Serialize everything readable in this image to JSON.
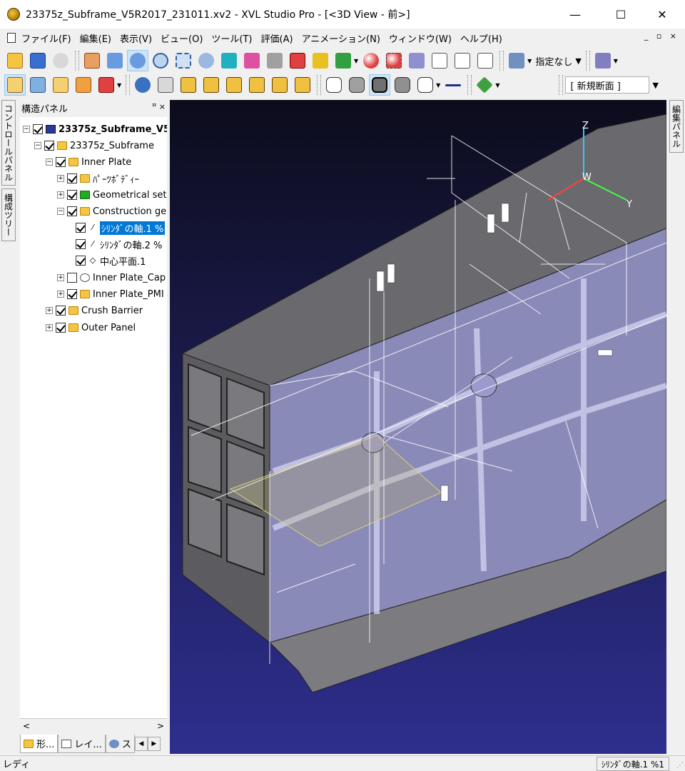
{
  "window": {
    "title": "23375z_Subframe_V5R2017_231011.xv2 - XVL Studio Pro - [<3D View - 前>]",
    "minimize": "—",
    "maximize": "☐",
    "close": "✕"
  },
  "menu": {
    "items": [
      "ファイル(F)",
      "編集(E)",
      "表示(V)",
      "ビュー(O)",
      "ツール(T)",
      "評価(A)",
      "アニメーション(N)",
      "ウィンドウ(W)",
      "ヘルプ(H)"
    ],
    "mdi_controls": "_ ▫ ×"
  },
  "toolbar": {
    "display_mode": "指定なし",
    "section_combo": "[ 新規断面 ]"
  },
  "panel": {
    "title": "構造パネル",
    "pin": "ꟸ ×",
    "tree": [
      {
        "label": "23375z_Subframe_V5R",
        "bold": true
      },
      {
        "label": "23375z_Subframe"
      },
      {
        "label": "Inner Plate"
      },
      {
        "label": "ﾊﾟｰﾂﾎﾞﾃﾞｨｰ"
      },
      {
        "label": "Geometrical set"
      },
      {
        "label": "Construction ge"
      },
      {
        "label": "ｼﾘﾝﾀﾞの軸.1 %"
      },
      {
        "label": "ｼﾘﾝﾀﾞの軸.2 %"
      },
      {
        "label": "中心平面.1"
      },
      {
        "label": "Inner Plate_Cap"
      },
      {
        "label": "Inner Plate_PMI"
      },
      {
        "label": "Crush Barrier"
      },
      {
        "label": "Outer Panel"
      }
    ],
    "tabs": [
      "形...",
      "レイ...",
      "ス"
    ]
  },
  "side_tabs": {
    "control_panel": "コントロールパネル",
    "structure_tree": "構成ツリー",
    "edit_panel": "編集パネル"
  },
  "viewport": {
    "axis_z": "Z",
    "axis_y": "Y",
    "axis_w": "W"
  },
  "status": {
    "left": "レディ",
    "right": "ｼﾘﾝﾀﾞの軸.1 %1"
  }
}
